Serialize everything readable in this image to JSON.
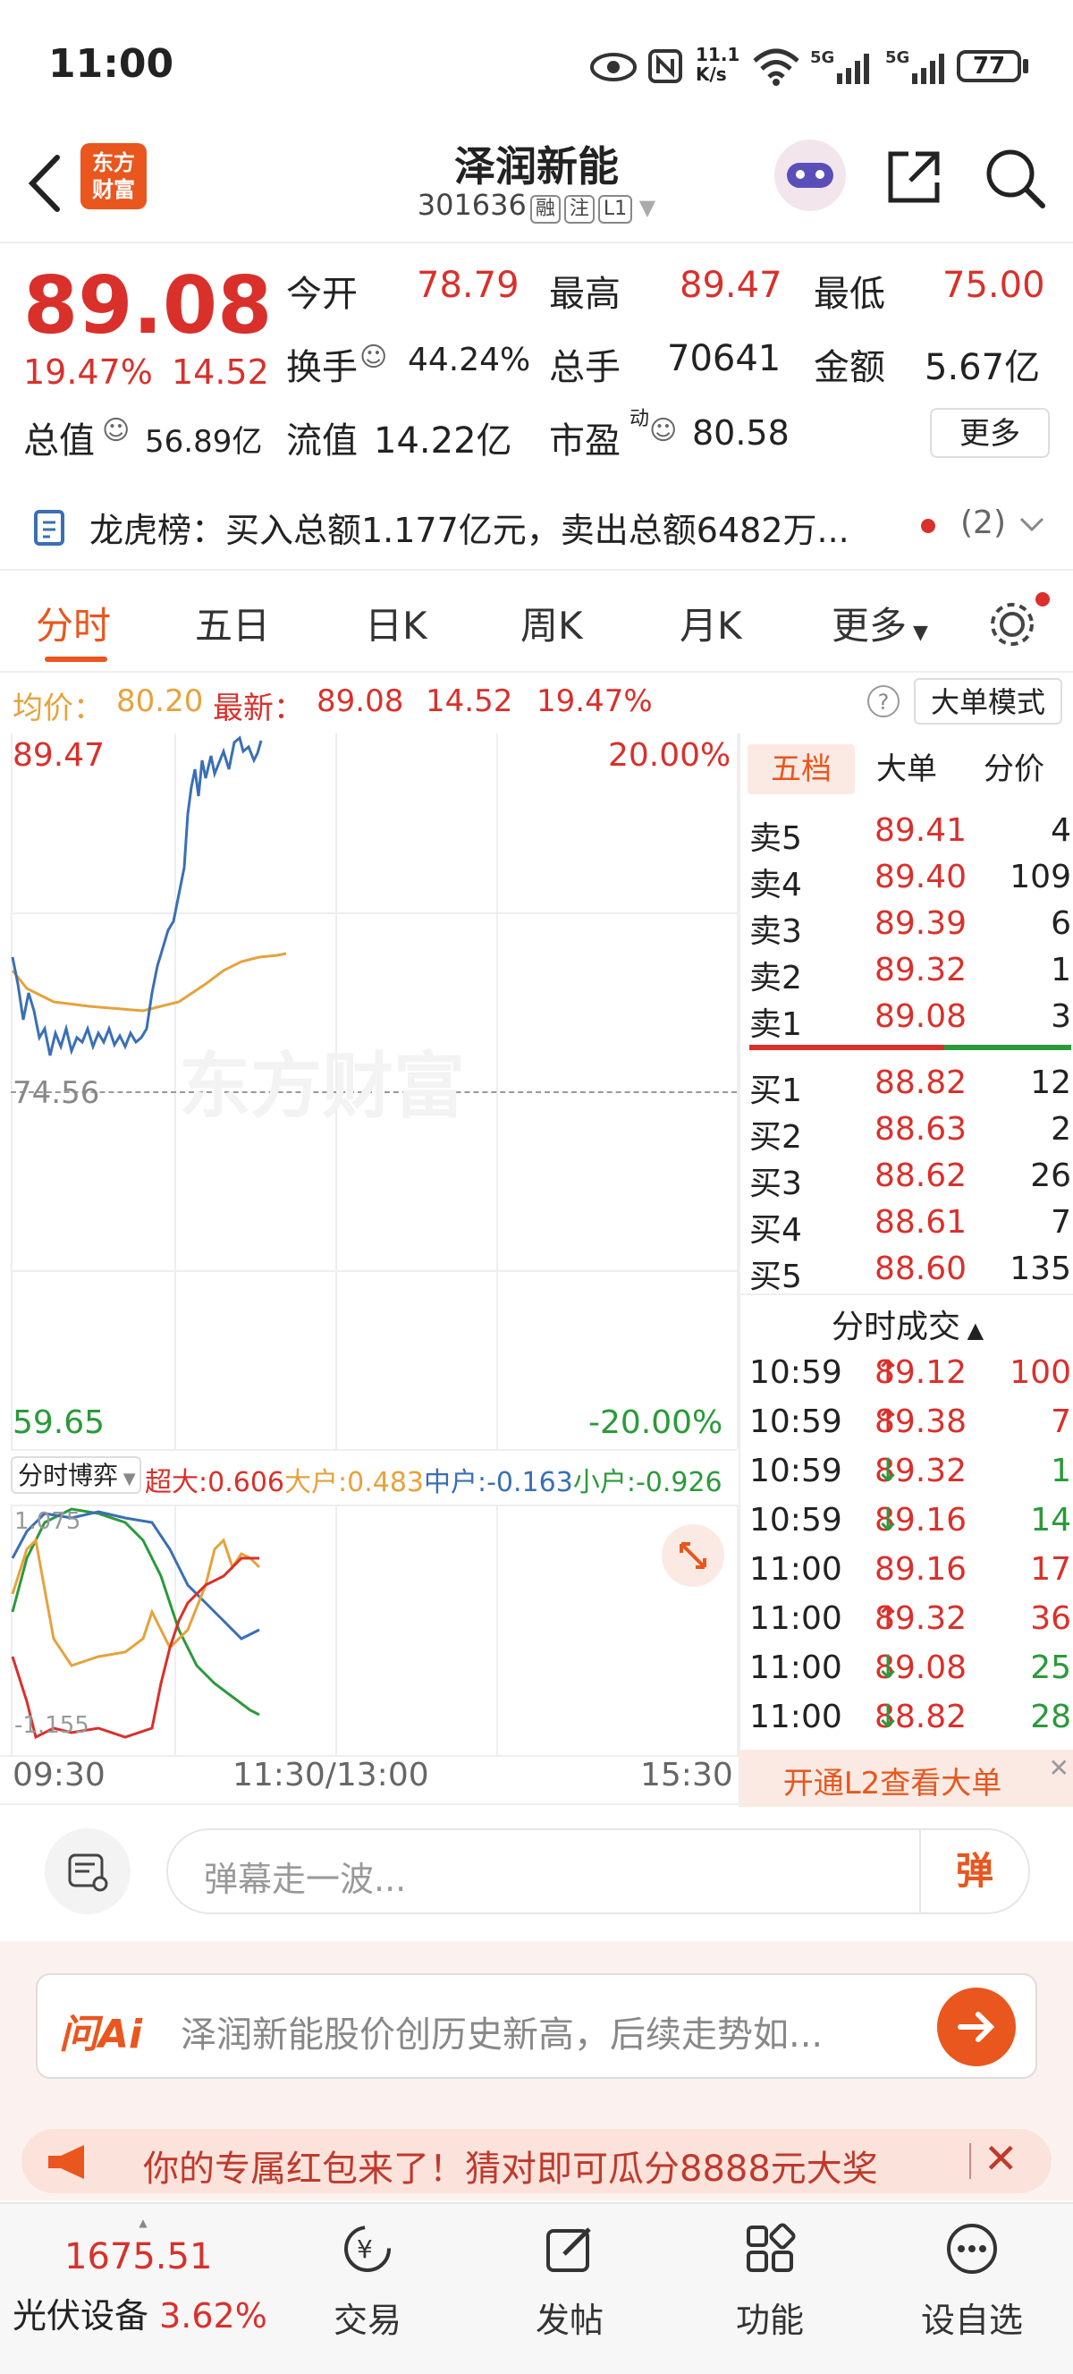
{
  "status_bar": {
    "time": "11:00",
    "net_speed_top": "11.1",
    "net_speed_unit": "K/s",
    "battery": "77"
  },
  "header": {
    "logo_line1": "东方",
    "logo_line2": "财富",
    "stock_name": "泽润新能",
    "stock_code": "301636",
    "tags": [
      "融",
      "注",
      "L1"
    ]
  },
  "quote": {
    "price": "89.08",
    "change_pct": "19.47%",
    "change_amt": "14.52",
    "open_label": "今开",
    "open": "78.79",
    "high_label": "最高",
    "high": "89.47",
    "low_label": "最低",
    "low": "75.00",
    "turnover_label": "换手",
    "turnover": "44.24%",
    "volume_label": "总手",
    "volume": "70641",
    "amount_label": "金额",
    "amount": "5.67亿",
    "mktcap_label": "总值",
    "mktcap": "56.89亿",
    "float_label": "流值",
    "float_cap": "14.22亿",
    "pe_label": "市盈",
    "pe_sup": "动",
    "pe": "80.58",
    "more_button": "更多"
  },
  "longhu": {
    "text": "龙虎榜：买入总额1.177亿元，卖出总额6482万...",
    "count": "(2)"
  },
  "tabs": [
    "分时",
    "五日",
    "日K",
    "周K",
    "月K",
    "更多",
    ""
  ],
  "avg_line": {
    "avg_label": "均价：",
    "avg": "80.20",
    "latest_label": "最新：",
    "latest": "89.08",
    "chg": "14.52",
    "pct": "19.47%",
    "help": "?",
    "mode_button": "大单模式"
  },
  "chart": {
    "price_top": "89.47",
    "pct_top": "20.00%",
    "prev_close": "74.56",
    "price_bottom": "59.65",
    "pct_bottom": "-20.00%",
    "watermark": "东方财富",
    "sub_selector": "分时博弈",
    "flow_labels": [
      {
        "label": "超大:",
        "value": "0.606",
        "color": "#d9302b"
      },
      {
        "label": "大户:",
        "value": "0.483",
        "color": "#e6a23c"
      },
      {
        "label": "中户:",
        "value": "-0.163",
        "color": "#3a6fb5"
      },
      {
        "label": "小户:",
        "value": "-0.926",
        "color": "#2a9a3a"
      }
    ],
    "sub_top": "1.075",
    "sub_bottom": "-1.155",
    "time_axis": [
      "09:30",
      "11:30/13:00",
      "15:30"
    ]
  },
  "book": {
    "tabs": [
      "五档",
      "大单",
      "分价"
    ],
    "asks": [
      {
        "label": "卖5",
        "price": "89.41",
        "vol": "4"
      },
      {
        "label": "卖4",
        "price": "89.40",
        "vol": "109"
      },
      {
        "label": "卖3",
        "price": "89.39",
        "vol": "6"
      },
      {
        "label": "卖2",
        "price": "89.32",
        "vol": "1"
      },
      {
        "label": "卖1",
        "price": "89.08",
        "vol": "3"
      }
    ],
    "bids": [
      {
        "label": "买1",
        "price": "88.82",
        "vol": "12"
      },
      {
        "label": "买2",
        "price": "88.63",
        "vol": "2"
      },
      {
        "label": "买3",
        "price": "88.62",
        "vol": "26"
      },
      {
        "label": "买4",
        "price": "88.61",
        "vol": "7"
      },
      {
        "label": "买5",
        "price": "88.60",
        "vol": "135"
      }
    ],
    "trades_title": "分时成交",
    "trades": [
      {
        "time": "10:59",
        "price": "89.12",
        "dir": "↑",
        "vol": "100"
      },
      {
        "time": "10:59",
        "price": "89.38",
        "dir": "↑",
        "vol": "7"
      },
      {
        "time": "10:59",
        "price": "89.32",
        "dir": "↓",
        "vol": "1"
      },
      {
        "time": "10:59",
        "price": "89.16",
        "dir": "↓",
        "vol": "14"
      },
      {
        "time": "11:00",
        "price": "89.16",
        "dir": "",
        "vol": "17"
      },
      {
        "time": "11:00",
        "price": "89.32",
        "dir": "↑",
        "vol": "36"
      },
      {
        "time": "11:00",
        "price": "89.08",
        "dir": "↓",
        "vol": "25"
      },
      {
        "time": "11:00",
        "price": "88.82",
        "dir": "↓",
        "vol": "28"
      }
    ],
    "l2_button": "开通L2查看大单"
  },
  "chat": {
    "placeholder": "弹幕走一波...",
    "danmu_button": "弹"
  },
  "ai": {
    "badge": "问Ai",
    "text": "泽润新能股价创历史新高，后续走势如..."
  },
  "promo": {
    "text": "你的专属红包来了！猜对即可瓜分8888元大奖"
  },
  "bottom_nav": {
    "index_value": "1675.51",
    "index_name": "光伏设备",
    "index_pct": "3.62%",
    "items": [
      "交易",
      "发帖",
      "功能",
      "设自选"
    ]
  }
}
